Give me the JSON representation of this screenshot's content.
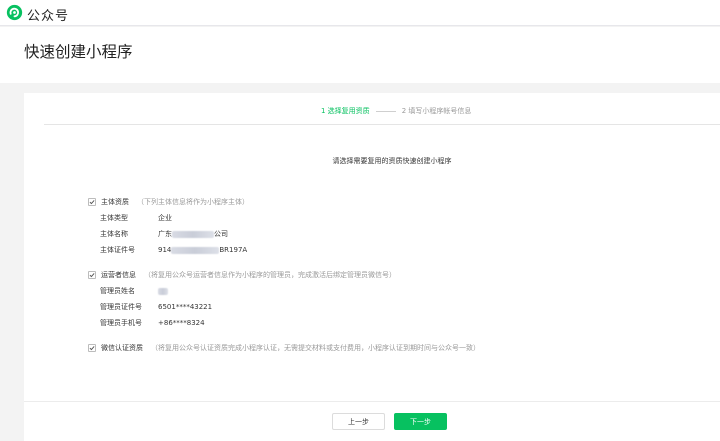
{
  "app": {
    "brand": "公众号",
    "brand_color": "#07c160"
  },
  "page": {
    "title": "快速创建小程序"
  },
  "steps": [
    {
      "label": "1 选择复用资质",
      "state": "active"
    },
    {
      "label": "2 填写小程序帐号信息",
      "state": "todo"
    }
  ],
  "prompt": "请选择需要复用的资质快速创建小程序",
  "sections": {
    "entity": {
      "title": "主体资质",
      "note": "（下列主体信息将作为小程序主体）",
      "checked": true,
      "rows": [
        {
          "label": "主体类型",
          "value_prefix": "企业",
          "value_suffix": ""
        },
        {
          "label": "主体名称",
          "value_prefix": "广东",
          "value_suffix": "公司"
        },
        {
          "label": "主体证件号",
          "value_prefix": "914",
          "value_suffix": "BR197A"
        }
      ]
    },
    "operator": {
      "title": "运营者信息",
      "note": "（将复用公众号运营者信息作为小程序的管理员，完成激活后绑定管理员微信号）",
      "checked": true,
      "rows": [
        {
          "label": "管理员姓名",
          "value_prefix": "",
          "value_suffix": ""
        },
        {
          "label": "管理员证件号",
          "value_prefix": "6501****43221",
          "value_suffix": ""
        },
        {
          "label": "管理员手机号",
          "value_prefix": "+86****8324",
          "value_suffix": ""
        }
      ]
    },
    "wechat_verify": {
      "title": "微信认证资质",
      "note": "（将复用公众号认证资质完成小程序认证，无需提交材料或支付费用，小程序认证到期时间与公众号一致）",
      "checked": true
    }
  },
  "buttons": {
    "prev": "上一步",
    "next": "下一步"
  }
}
